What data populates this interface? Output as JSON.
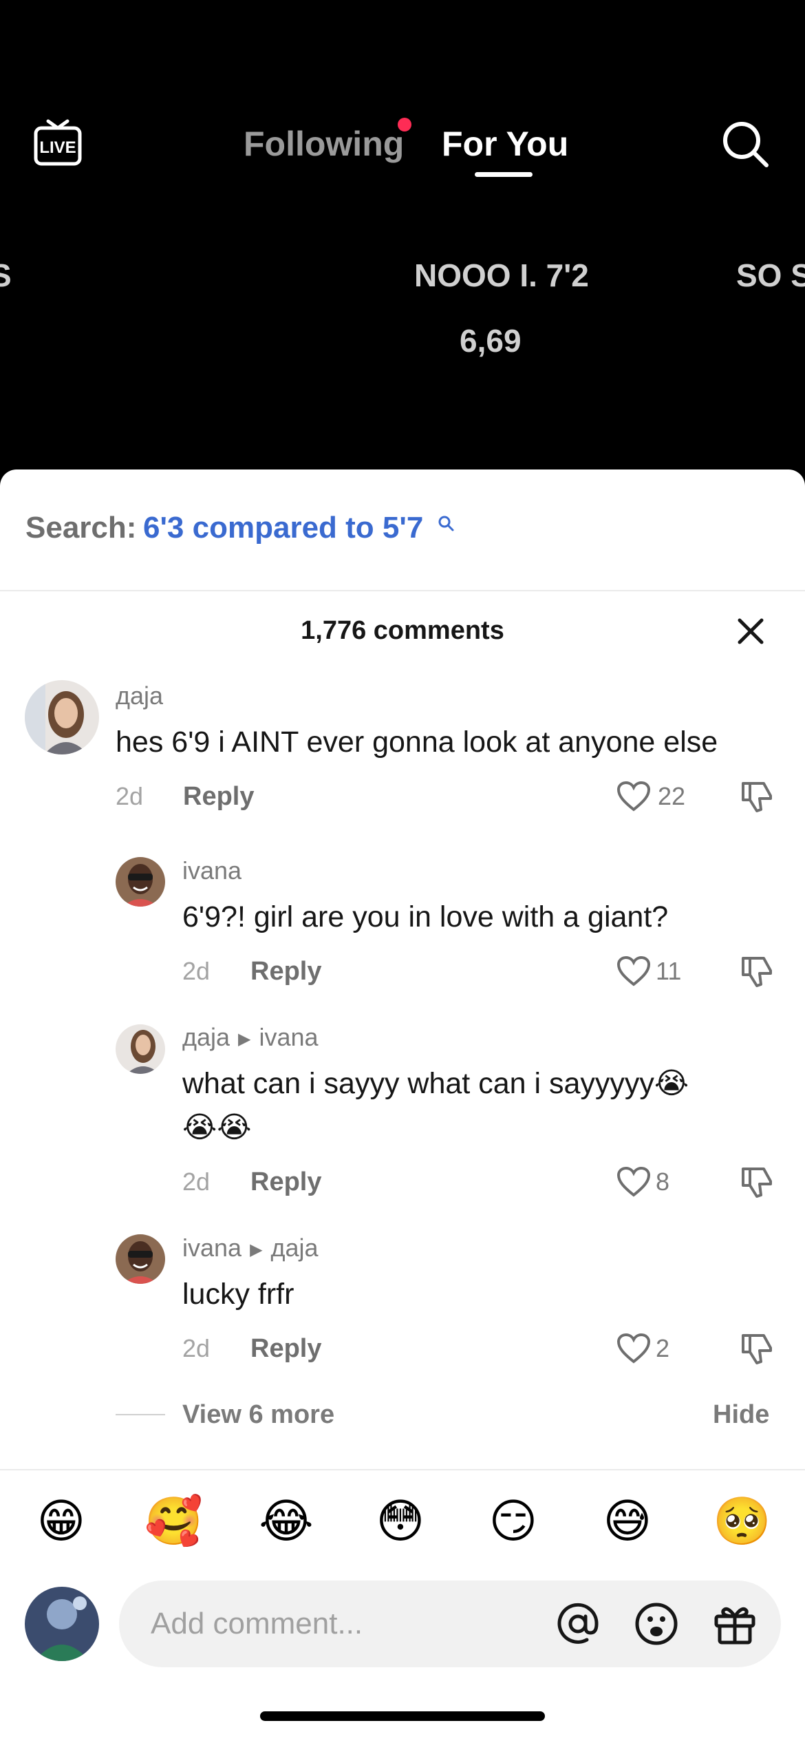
{
  "header": {
    "live_label": "LIVE",
    "tabs": [
      {
        "label": "Following",
        "has_notification_dot": true
      },
      {
        "label": "For You",
        "active": true
      }
    ],
    "search_icon": "search-icon"
  },
  "video_overlay": {
    "left_text": "S",
    "center_text": "NOOO I. 7'2",
    "center_subtext": "6,69",
    "right_text": "SO S"
  },
  "comments_sheet": {
    "search_prefix": "Search:",
    "search_term": "6'3 compared to 5'7",
    "count_label": "1,776 comments",
    "comments": [
      {
        "username": "даја",
        "reply_to": "",
        "text": "hes 6'9 i AINT ever gonna look at anyone else",
        "time": "2d",
        "reply_label": "Reply",
        "likes": "22"
      },
      {
        "username": "ivana",
        "reply_to": "",
        "text": "6'9?! girl are you in love with a giant?",
        "time": "2d",
        "reply_label": "Reply",
        "likes": "11"
      },
      {
        "username": "даја",
        "reply_to": "ivana",
        "text": "what can i sayyy what can i sayyyyy😭",
        "text2": "😭😭",
        "time": "2d",
        "reply_label": "Reply",
        "likes": "8"
      },
      {
        "username": "ivana",
        "reply_to": "даја",
        "text": "lucky frfr",
        "time": "2d",
        "reply_label": "Reply",
        "likes": "2"
      }
    ],
    "view_more_label": "View 6 more",
    "hide_label": "Hide"
  },
  "emoji_bar": [
    "😁",
    "🥰",
    "😂",
    "😳",
    "😏",
    "😅",
    "🥺"
  ],
  "composer": {
    "placeholder": "Add comment...",
    "icons": [
      "at-icon",
      "emoji-icon",
      "gift-icon"
    ]
  },
  "colors": {
    "accent_red": "#fe2c55",
    "search_link_blue": "#3a6ad0",
    "background_dark": "#000000",
    "sheet_background": "#ffffff"
  }
}
